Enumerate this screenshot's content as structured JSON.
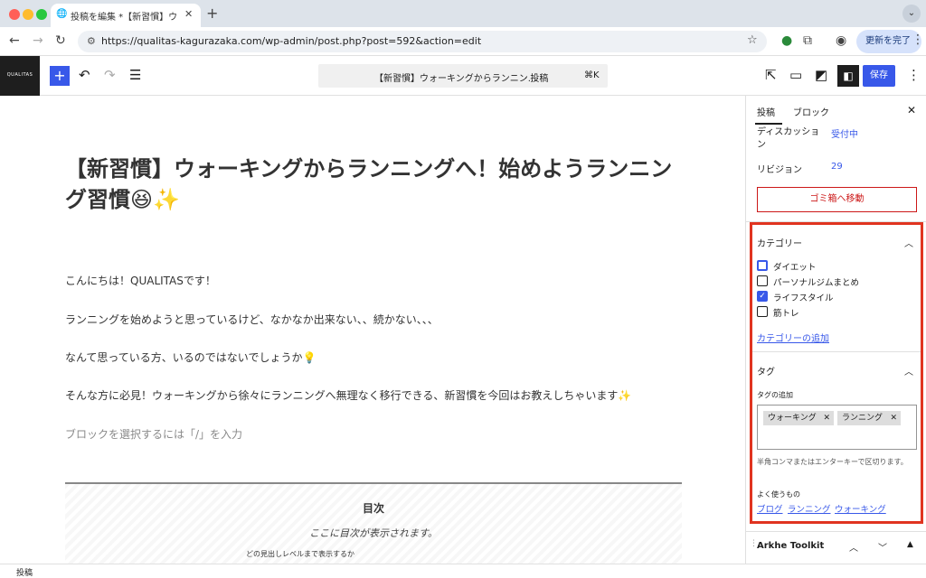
{
  "browser": {
    "tab_title": "投稿を編集 *【新習慣】ウォーキ",
    "url": "https://qualitas-kagurazaka.com/wp-admin/post.php?post=592&action=edit",
    "update_label": "更新を完了"
  },
  "editor_header": {
    "site_logo": "QUALITAS",
    "document_title": "【新習慣】ウォーキングからランニン...",
    "document_type": "· 投稿",
    "shortcut": "⌘K",
    "save_label": "保存"
  },
  "post": {
    "title": "【新習慣】ウォーキングからランニングへ！始めようランニング習慣😆✨",
    "paragraphs": [
      "こんにちは！QUALITASです！",
      "ランニングを始めようと思っているけど、なかなか出来ない、、続かない、、、",
      "なんて思っている方、いるのではないでしょうか💡",
      "そんな方に必見！ウォーキングから徐々にランニングへ無理なく移行できる、新習慣を今回はお教えしちゃいます✨"
    ],
    "block_placeholder": "ブロックを選択するには「/」を入力",
    "toc": {
      "title": "目次",
      "placeholder": "ここに目次が表示されます。",
      "level_label": "どの見出しレベルまで表示するか"
    }
  },
  "sidebar": {
    "tabs": [
      "投稿",
      "ブロック"
    ],
    "discussion_label": "ディスカッション",
    "discussion_value": "受付中",
    "revisions_label": "リビジョン",
    "revisions_value": "29",
    "trash_label": "ゴミ箱へ移動",
    "categories": {
      "title": "カテゴリー",
      "items": [
        {
          "label": "ダイエット",
          "checked": false
        },
        {
          "label": "パーソナルジムまとめ",
          "checked": false
        },
        {
          "label": "ライフスタイル",
          "checked": true
        },
        {
          "label": "筋トレ",
          "checked": false
        }
      ],
      "add_label": "カテゴリーの追加"
    },
    "tags": {
      "title": "タグ",
      "input_label": "タグの追加",
      "chips": [
        "ウォーキング",
        "ランニング"
      ],
      "hint": "半角コンマまたはエンターキーで区切ります。",
      "frequent_label": "よく使うもの",
      "frequent": [
        "ブログ",
        "ランニング",
        "ウォーキング"
      ]
    },
    "arkhe_title": "Arkhe Toolkit"
  },
  "footer": {
    "breadcrumb": "投稿"
  },
  "colors": {
    "accent": "#3858e9",
    "highlight": "#e03420",
    "danger": "#cc1818"
  }
}
